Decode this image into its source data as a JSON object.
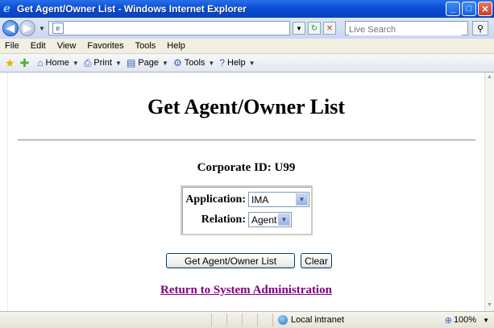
{
  "window": {
    "title": "Get Agent/Owner List - Windows Internet Explorer",
    "ie_icon": "ie-icon",
    "controls": [
      "minimize",
      "maximize",
      "close"
    ]
  },
  "address_bar": {
    "url": "",
    "search_placeholder": "Live Search"
  },
  "menu": [
    "File",
    "Edit",
    "View",
    "Favorites",
    "Tools",
    "Help"
  ],
  "command_bar": {
    "home": "Home",
    "print": "Print",
    "page": "Page",
    "tools": "Tools",
    "help": "Help"
  },
  "page": {
    "heading": "Get Agent/Owner List",
    "corporate_id": "Corporate ID: U99",
    "application_label": "Application:",
    "application_value": "IMA",
    "relation_label": "Relation:",
    "relation_value": "Agent",
    "get_button": "Get Agent/Owner List",
    "clear_button": "Clear",
    "return_link": "Return to System Administration",
    "link_color": "#800080"
  },
  "status_bar": {
    "zone": "Local intranet",
    "zoom": "100%"
  }
}
